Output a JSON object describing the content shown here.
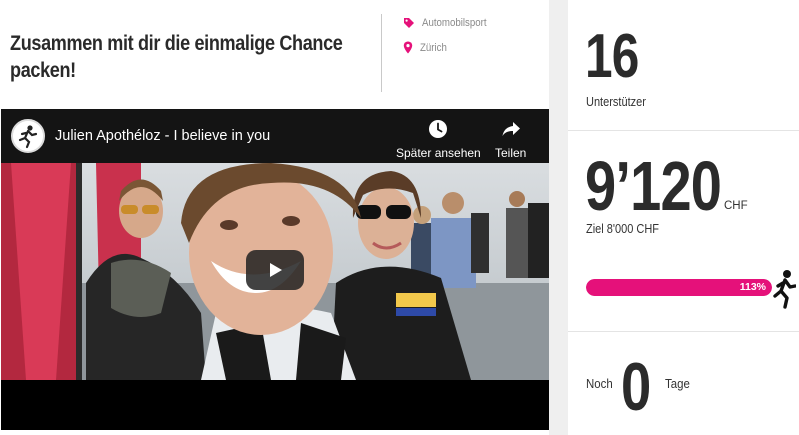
{
  "campaign": {
    "title": "Zusammen mit dir die einmalige Chance packen!",
    "category": "Automobilsport",
    "location": "Zürich"
  },
  "video": {
    "title": "Julien Apothéloz - I believe in you",
    "watch_later_label": "Später ansehen",
    "share_label": "Teilen"
  },
  "stats": {
    "supporters_count": "16",
    "supporters_label": "Unterstützer",
    "amount_raised": "9’120",
    "currency": "CHF",
    "goal_label": "Ziel 8'000 CHF",
    "progress_percent_label": "113%",
    "progress_fraction": 1.0,
    "days_prefix": "Noch",
    "days_left": "0",
    "days_suffix": "Tage"
  },
  "colors": {
    "accent": "#e5117a",
    "text_dark": "#2b2b2b",
    "meta_gray": "#8a8a8a"
  },
  "icons": {
    "category": "tag-icon",
    "location": "map-pin-icon",
    "watch_later": "clock-icon",
    "share": "share-arrow-icon",
    "play": "play-icon",
    "runner": "runner-icon"
  }
}
